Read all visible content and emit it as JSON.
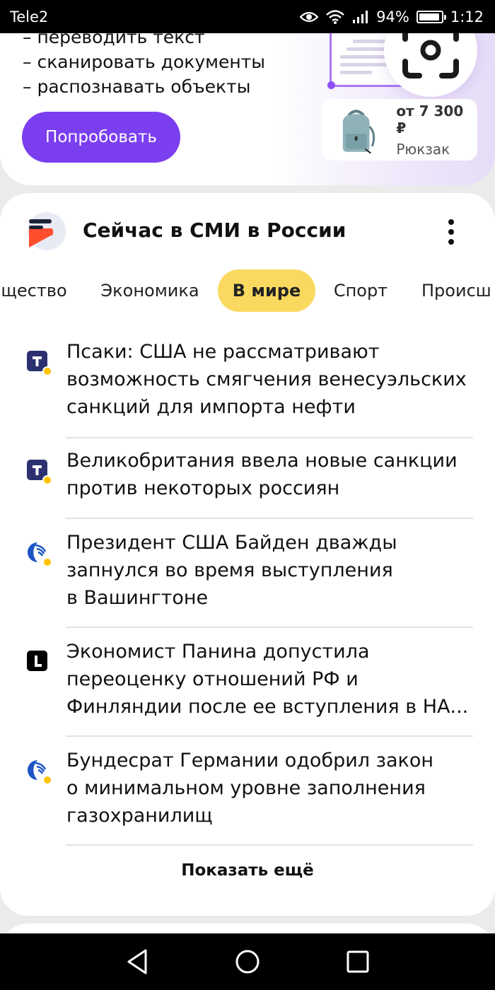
{
  "status_bar": {
    "carrier": "Tele2",
    "battery": "94%",
    "battery_level": 0.94,
    "time": "1:12",
    "icons": [
      "eye-comfort-icon",
      "wifi-icon",
      "signal-icon",
      "battery-icon"
    ]
  },
  "promo": {
    "lines": [
      "– переводить текст",
      "– сканировать документы",
      "– распознавать объекты"
    ],
    "button_label": "Попробовать",
    "product_price": "от 7 300 ₽",
    "product_name": "Рюкзак",
    "accent_color": "#7b3ff0"
  },
  "news_widget": {
    "title": "Сейчас в СМИ в России",
    "tabs": [
      "щество",
      "Экономика",
      "В мире",
      "Спорт",
      "Происш"
    ],
    "active_tab": "В мире",
    "active_tab_color": "#fad960",
    "items": [
      {
        "source_icon": "tass-icon",
        "lines": [
          "Псаки: США не рассматривают",
          "возможность смягчения венесуэльских",
          "санкций для импорта нефти"
        ]
      },
      {
        "source_icon": "tass-icon",
        "lines": [
          "Великобритания ввела новые санкции",
          "против некоторых россиян"
        ]
      },
      {
        "source_icon": "globe-source-icon",
        "lines": [
          "Президент США Байден дважды",
          "запнулся во время выступления",
          "в Вашингтоне"
        ]
      },
      {
        "source_icon": "l-source-icon",
        "lines": [
          "Экономист Панина допустила",
          "переоценку отношений РФ и",
          "Финляндии после ее вступления в НА..."
        ]
      },
      {
        "source_icon": "globe-source-icon",
        "lines": [
          "Бундесрат Германии одобрил закон",
          "о минимальном уровне заполнения",
          "газохранилищ"
        ]
      }
    ],
    "show_more_label": "Показать ещё"
  },
  "nav_bar": {
    "buttons": [
      "back-icon",
      "home-icon",
      "recents-icon"
    ]
  }
}
